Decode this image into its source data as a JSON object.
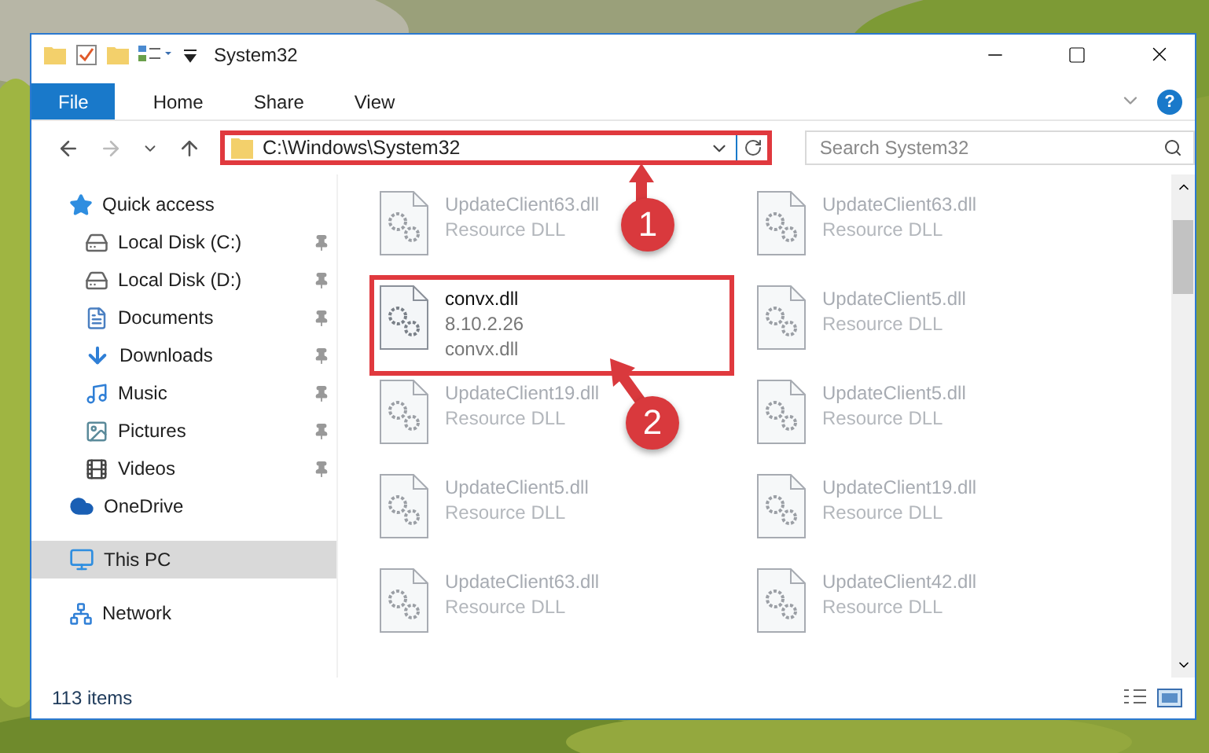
{
  "window": {
    "title": "System32"
  },
  "ribbon": {
    "tabs": [
      {
        "label": "File",
        "kind": "file"
      },
      {
        "label": "Home",
        "kind": "tab"
      },
      {
        "label": "Share",
        "kind": "tab"
      },
      {
        "label": "View",
        "kind": "tab"
      }
    ],
    "help": "?"
  },
  "address": {
    "path": "C:\\Windows\\System32",
    "boxed": true
  },
  "search": {
    "placeholder": "Search System32"
  },
  "nav": [
    {
      "label": "Quick access",
      "selected": false,
      "children": [
        {
          "label": "Local Disk (C:)",
          "pinned": true
        },
        {
          "label": "Local Disk (D:)",
          "pinned": true
        },
        {
          "label": "Documents",
          "pinned": true
        },
        {
          "label": "Downloads",
          "pinned": true
        },
        {
          "label": "Music",
          "pinned": true
        },
        {
          "label": "Pictures",
          "pinned": true
        },
        {
          "label": "Videos",
          "pinned": true
        }
      ]
    },
    {
      "label": "OneDrive",
      "selected": false
    },
    {
      "label": "This PC",
      "selected": true
    },
    {
      "label": "Network",
      "selected": false
    }
  ],
  "files": [
    {
      "name": "UpdateClient63.dll",
      "lines": [
        "Resource DLL"
      ],
      "kind": "faded",
      "boxed": false
    },
    {
      "name": "UpdateClient63.dll",
      "lines": [
        "Resource DLL"
      ],
      "kind": "faded",
      "boxed": false
    },
    {
      "name": "convx.dll",
      "lines": [
        "8.10.2.26",
        "convx.dll"
      ],
      "kind": "focus",
      "boxed": true
    },
    {
      "name": "UpdateClient5.dll",
      "lines": [
        "Resource DLL"
      ],
      "kind": "faded",
      "boxed": false
    },
    {
      "name": "UpdateClient19.dll",
      "lines": [
        "Resource DLL"
      ],
      "kind": "faded",
      "boxed": false
    },
    {
      "name": "UpdateClient5.dll",
      "lines": [
        "Resource DLL"
      ],
      "kind": "faded",
      "boxed": false
    },
    {
      "name": "UpdateClient5.dll",
      "lines": [
        "Resource DLL"
      ],
      "kind": "faded",
      "boxed": false
    },
    {
      "name": "UpdateClient19.dll",
      "lines": [
        "Resource DLL"
      ],
      "kind": "faded",
      "boxed": false
    },
    {
      "name": "UpdateClient63.dll",
      "lines": [
        "Resource DLL"
      ],
      "kind": "faded",
      "boxed": false
    },
    {
      "name": "UpdateClient42.dll",
      "lines": [
        "Resource DLL"
      ],
      "kind": "faded",
      "boxed": false
    }
  ],
  "status_bar": {
    "count": "113 items"
  },
  "callouts": [
    {
      "number": "1"
    },
    {
      "number": "2"
    }
  ]
}
